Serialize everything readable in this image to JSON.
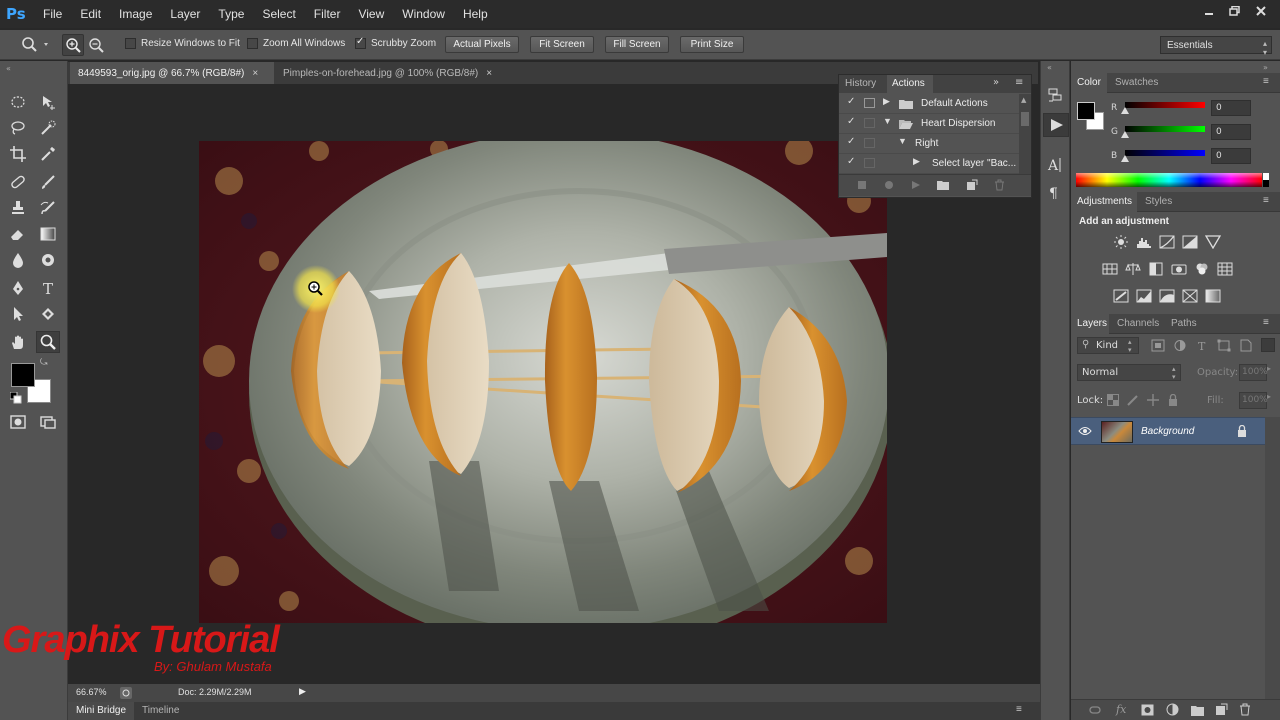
{
  "app": {
    "logo": "Ps",
    "menu": [
      "File",
      "Edit",
      "Image",
      "Layer",
      "Type",
      "Select",
      "Filter",
      "View",
      "Window",
      "Help"
    ],
    "window_controls": [
      "minimize-icon",
      "restore-icon",
      "close-icon"
    ]
  },
  "options": {
    "resize_windows_label": "Resize Windows to Fit",
    "resize_windows_checked": false,
    "zoom_all_label": "Zoom All Windows",
    "zoom_all_checked": false,
    "scrubby_label": "Scrubby Zoom",
    "scrubby_checked": true,
    "buttons": [
      "Actual Pixels",
      "Fit Screen",
      "Fill Screen",
      "Print Size"
    ],
    "workspace": "Essentials"
  },
  "documents": {
    "tabs": [
      {
        "label": "8449593_orig.jpg @ 66.7% (RGB/8#)",
        "active": true
      },
      {
        "label": "Pimples-on-forehead.jpg @ 100% (RGB/8#)",
        "active": false
      }
    ]
  },
  "status": {
    "zoom": "66.67%",
    "doc_info": "Doc: 2.29M/2.29M"
  },
  "bottom_tabs": [
    "Mini Bridge",
    "Timeline"
  ],
  "actions_panel": {
    "tabs": [
      "History",
      "Actions"
    ],
    "active_tab": "Actions",
    "rows": [
      {
        "label": "Default Actions",
        "expanded": false,
        "level": 0,
        "type": "set"
      },
      {
        "label": "Heart Dispersion",
        "expanded": true,
        "level": 0,
        "type": "set"
      },
      {
        "label": "Right",
        "expanded": true,
        "level": 1,
        "type": "action"
      },
      {
        "label": "Select layer \"Bac...",
        "expanded": false,
        "level": 2,
        "type": "step"
      }
    ]
  },
  "color_panel": {
    "tabs": [
      "Color",
      "Swatches"
    ],
    "channels": [
      {
        "name": "R",
        "value": "0"
      },
      {
        "name": "G",
        "value": "0"
      },
      {
        "name": "B",
        "value": "0"
      }
    ],
    "foreground": "#000000",
    "background": "#ffffff"
  },
  "adjustments_panel": {
    "tabs": [
      "Adjustments",
      "Styles"
    ],
    "title": "Add an adjustment"
  },
  "layers_panel": {
    "tabs": [
      "Layers",
      "Channels",
      "Paths"
    ],
    "filter_kind": "Kind",
    "blend_mode": "Normal",
    "opacity_label": "Opacity:",
    "opacity_value": "100%",
    "lock_label": "Lock:",
    "fill_label": "Fill:",
    "fill_value": "100%",
    "layers": [
      {
        "name": "Background",
        "visible": true,
        "locked": true,
        "selected": true
      }
    ]
  },
  "watermark": {
    "title": "Graphix Tutorial",
    "subtitle": "By: Ghulam Mustafa"
  },
  "colors": {
    "panel_bg": "#535353",
    "canvas_bg": "#282828",
    "selected_layer": "#4a5f7d",
    "ps_blue": "#3ea6ff",
    "watermark_red": "#d81818"
  }
}
